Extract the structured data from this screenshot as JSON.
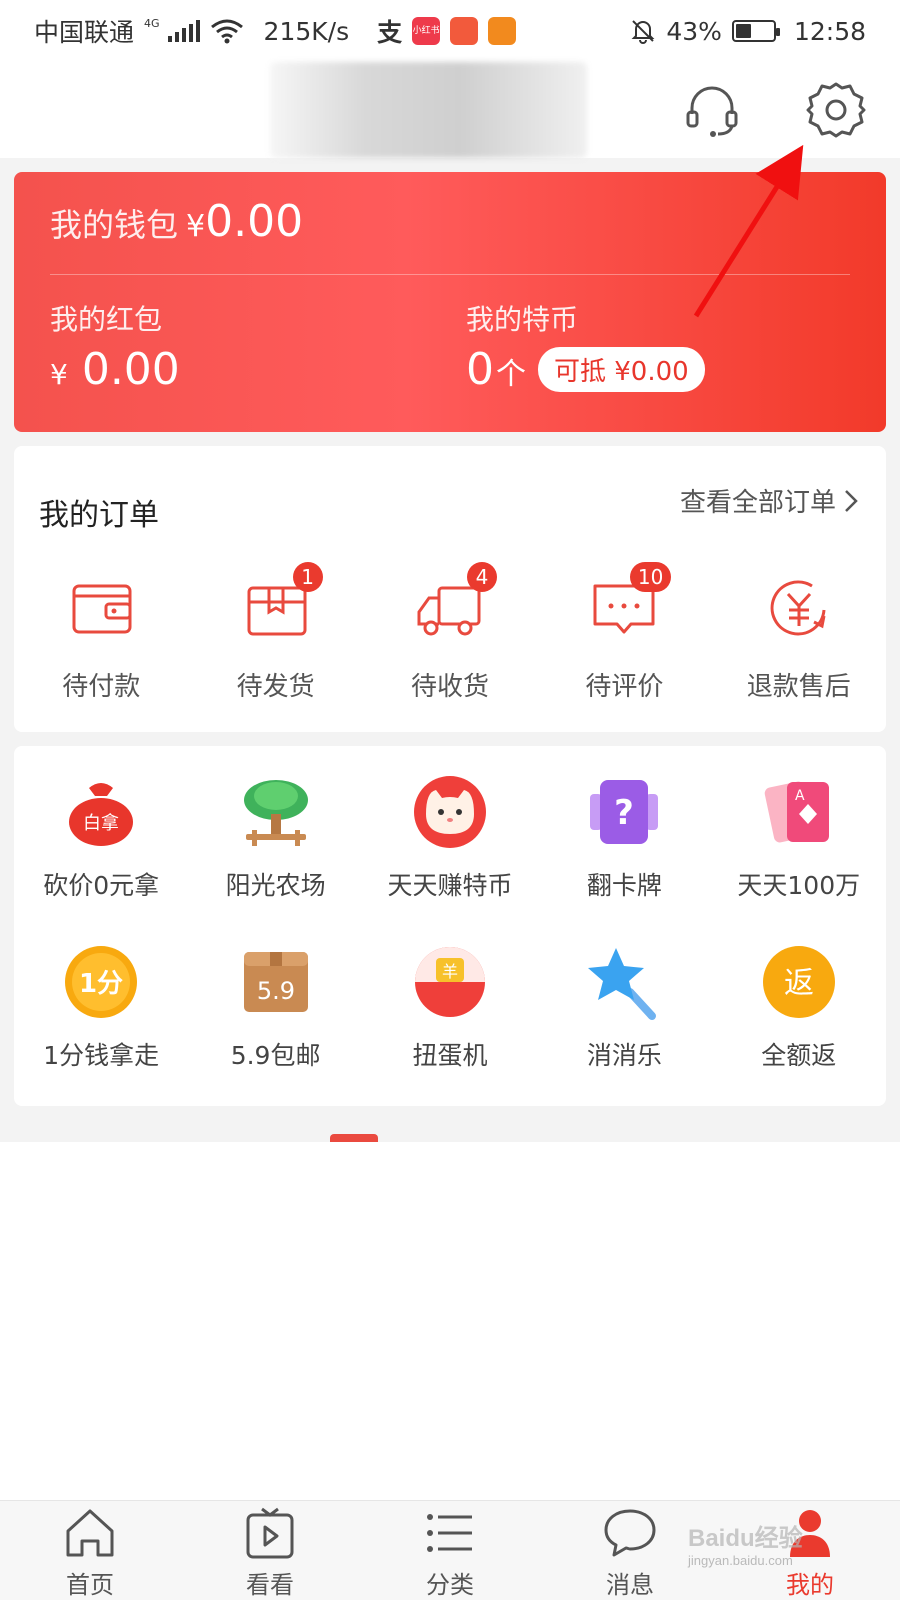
{
  "status_bar": {
    "carrier": "中国联通",
    "network": "4G",
    "speed": "215K/s",
    "app_icons": [
      {
        "name": "alipay-icon",
        "text": "支"
      },
      {
        "name": "xiaohongshu-icon",
        "text": "小红书",
        "color": "#ee3a4b"
      },
      {
        "name": "kuaishou-icon",
        "text": "",
        "color": "#f25a3c"
      },
      {
        "name": "hand-app-icon",
        "text": "",
        "color": "#f28a1e"
      }
    ],
    "battery_pct": "43%",
    "battery_level": 0.43,
    "time": "12:58"
  },
  "header": {
    "support_icon": "headset-icon",
    "settings_icon": "gear-icon"
  },
  "wallet": {
    "title_label": "我的钱包",
    "title_symbol": "¥",
    "title_amount": "0.00",
    "red_packet_label": "我的红包",
    "red_packet_symbol": "¥",
    "red_packet_amount": "0.00",
    "coin_label": "我的特币",
    "coin_count": "0",
    "coin_unit": "个",
    "coin_pill": "可抵 ¥0.00"
  },
  "orders": {
    "title": "我的订单",
    "view_all": "查看全部订单",
    "items": [
      {
        "label": "待付款",
        "icon": "wallet-icon",
        "badge": ""
      },
      {
        "label": "待发货",
        "icon": "box-icon",
        "badge": "1"
      },
      {
        "label": "待收货",
        "icon": "truck-icon",
        "badge": "4"
      },
      {
        "label": "待评价",
        "icon": "comment-icon",
        "badge": "10"
      },
      {
        "label": "退款售后",
        "icon": "refund-icon",
        "badge": ""
      }
    ]
  },
  "services": {
    "row1": [
      {
        "label": "砍价0元拿",
        "icon": "money-bag-icon",
        "icon_text": "白拿"
      },
      {
        "label": "阳光农场",
        "icon": "tree-icon"
      },
      {
        "label": "天天赚特币",
        "icon": "cat-icon"
      },
      {
        "label": "翻卡牌",
        "icon": "question-card-icon"
      },
      {
        "label": "天天100万",
        "icon": "playing-cards-icon"
      }
    ],
    "row2": [
      {
        "label": "1分钱拿走",
        "icon": "one-cent-icon",
        "icon_text": "1分"
      },
      {
        "label": "5.9包邮",
        "icon": "parcel-icon",
        "icon_text": "5.9"
      },
      {
        "label": "扭蛋机",
        "icon": "gacha-icon",
        "icon_text": "羊"
      },
      {
        "label": "消消乐",
        "icon": "star-wand-icon"
      },
      {
        "label": "全额返",
        "icon": "rebate-icon",
        "icon_text": "返"
      }
    ]
  },
  "tabbar": {
    "tabs": [
      {
        "label": "首页",
        "icon": "home-icon",
        "active": false
      },
      {
        "label": "看看",
        "icon": "video-icon",
        "active": false
      },
      {
        "label": "分类",
        "icon": "list-icon",
        "active": false
      },
      {
        "label": "消息",
        "icon": "chat-bubble-icon",
        "active": false
      },
      {
        "label": "我的",
        "icon": "profile-icon",
        "active": true
      }
    ]
  },
  "watermark": {
    "main": "Baidu经验",
    "sub": "jingyan.baidu.com"
  },
  "colors": {
    "accent": "#ea3a2e",
    "wallet_start": "#f4524d",
    "wallet_end": "#f23a2a"
  }
}
